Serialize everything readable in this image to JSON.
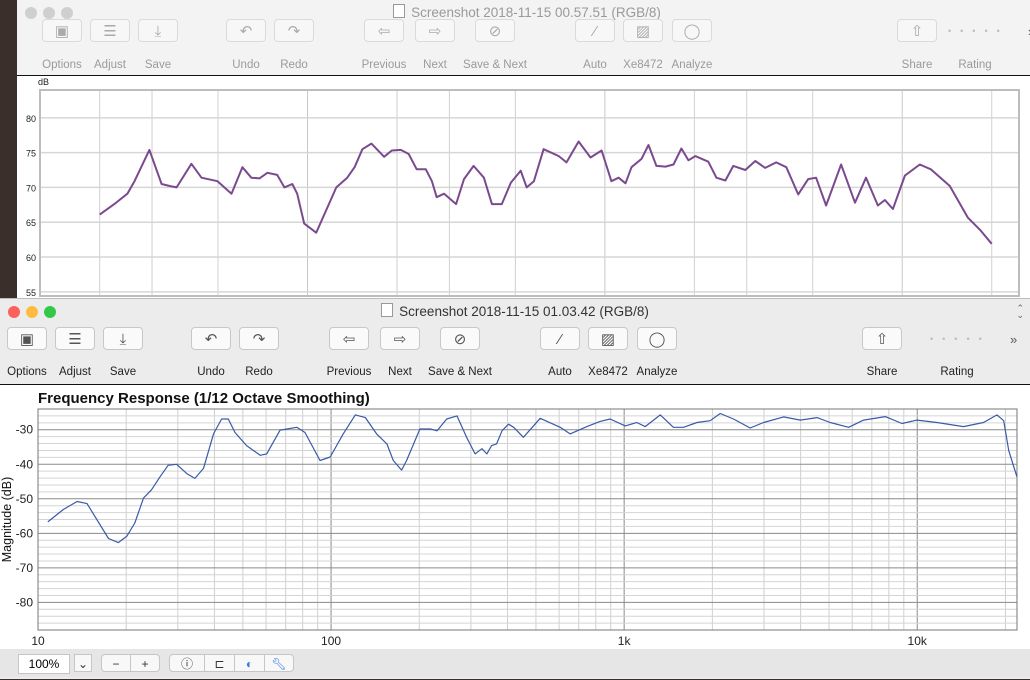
{
  "back_window": {
    "title": "Screenshot 2018-11-15 00.57.51 (RGB/8)",
    "active": false
  },
  "front_window": {
    "title": "Screenshot 2018-11-15 01.03.42 (RGB/8)",
    "active": true,
    "zoom_level": "100%"
  },
  "toolbar": {
    "options": "Options",
    "adjust": "Adjust",
    "save": "Save",
    "undo": "Undo",
    "redo": "Redo",
    "previous": "Previous",
    "next": "Next",
    "save_next": "Save & Next",
    "auto": "Auto",
    "xe8472": "Xe8472",
    "analyze": "Analyze",
    "share": "Share",
    "rating": "Rating"
  },
  "colors": {
    "close": "#fc605c",
    "minimize": "#fdbc40",
    "zoom": "#34c84a",
    "rew_trace": "#7b4a8e",
    "trace": "#3a5aa8"
  },
  "chart_data": [
    {
      "type": "line",
      "title": "",
      "ylabel": "dB",
      "xlabel": "",
      "xscale": "log",
      "xlim": [
        12.6,
        24700
      ],
      "ylim": [
        54.4,
        84
      ],
      "yticks": [
        55,
        60,
        65,
        70,
        75,
        80
      ],
      "grid": true,
      "series": [
        {
          "x": [
            20,
            22.4,
            24.8,
            26.2,
            29.4,
            32.3,
            34.4,
            36.3,
            40.7,
            44,
            49.8,
            55.5,
            60.4,
            64.7,
            68.9,
            73.3,
            79.1,
            83.6,
            88.9,
            92.3,
            97.5,
            107,
            118,
            125,
            136,
            144,
            153,
            164,
            181,
            192,
            206,
            219,
            233,
            250,
            262,
            272,
            288,
            316,
            336,
            362,
            392,
            417,
            450,
            483,
            521,
            546,
            577,
            622,
            700,
            743,
            816,
            895,
            975,
            1052,
            1112,
            1173,
            1229,
            1328,
            1402,
            1490,
            1599,
            1701,
            1808,
            1910,
            2015,
            2228,
            2371,
            2542,
            2704,
            2966,
            3206,
            3460,
            3768,
            4074,
            4467,
            4830,
            5131,
            5548,
            6227,
            6935,
            7553,
            8282,
            8746,
            9305,
            10207,
            11460,
            12480,
            14450,
            16600,
            18360,
            20000
          ],
          "y": [
            66.1,
            67.6,
            69.1,
            70.9,
            75.4,
            70.5,
            70.2,
            70.0,
            73.4,
            71.4,
            70.9,
            69.1,
            72.9,
            71.4,
            71.3,
            72.1,
            71.8,
            70.0,
            70.5,
            69.1,
            64.8,
            63.5,
            67.6,
            70.0,
            71.4,
            72.9,
            75.5,
            76.3,
            74.4,
            75.3,
            75.4,
            74.8,
            72.6,
            72.6,
            70.9,
            68.6,
            69.1,
            67.6,
            71.2,
            73.1,
            71.4,
            67.6,
            67.6,
            70.7,
            72.4,
            70.0,
            70.9,
            75.5,
            74.5,
            73.6,
            76.6,
            74.3,
            75.3,
            70.9,
            71.4,
            70.6,
            72.9,
            74.1,
            76.1,
            73.1,
            73.0,
            73.3,
            75.6,
            73.9,
            74.5,
            73.7,
            71.4,
            71.0,
            73.1,
            72.5,
            73.8,
            72.8,
            73.6,
            72.9,
            69.0,
            71.2,
            71.4,
            67.4,
            73.3,
            67.8,
            71.4,
            67.4,
            68.2,
            66.9,
            71.7,
            73.3,
            72.6,
            70.2,
            65.7,
            63.8,
            61.9
          ]
        }
      ]
    },
    {
      "type": "line",
      "title": "Frequency Response (1/12 Octave Smoothing)",
      "ylabel": "Magnitude (dB)",
      "xlabel": "",
      "xscale": "log",
      "xlim": [
        10,
        21900
      ],
      "ylim": [
        -88,
        -24
      ],
      "xticks": [
        {
          "value": 10,
          "label": "10"
        },
        {
          "value": 100,
          "label": "100"
        },
        {
          "value": 1000,
          "label": "1k"
        },
        {
          "value": 10000,
          "label": "10k"
        }
      ],
      "yticks": [
        -30,
        -40,
        -50,
        -60,
        -70,
        -80
      ],
      "grid": true,
      "series": [
        {
          "x": [
            10.8,
            12.2,
            13.6,
            14.7,
            17.4,
            18.8,
            20.1,
            21.4,
            22.9,
            24.4,
            26.1,
            27.8,
            29.7,
            32.2,
            34.3,
            36.7,
            39.7,
            42.3,
            44.6,
            47,
            51.5,
            57.3,
            60.3,
            67,
            76.4,
            81.5,
            91.7,
            99.3,
            110,
            121,
            131,
            143,
            155,
            163,
            174,
            181,
            201,
            218,
            230,
            248,
            269,
            290,
            310,
            327,
            340,
            353,
            367,
            383,
            403,
            420,
            453,
            517,
            605,
            654,
            746,
            828,
            896,
            1008,
            1104,
            1180,
            1328,
            1473,
            1594,
            1772,
            1966,
            2127,
            2362,
            2692,
            2992,
            3499,
            3990,
            4550,
            5047,
            5834,
            6561,
            7780,
            8870,
            9980,
            11670,
            14390,
            16830,
            18710,
            19720,
            20510,
            21880
          ],
          "y": [
            -56.7,
            -53.1,
            -50.8,
            -51.4,
            -61.5,
            -62.7,
            -60.8,
            -57.0,
            -49.8,
            -47.4,
            -43.6,
            -40.3,
            -40.0,
            -42.7,
            -44.1,
            -41.2,
            -31.2,
            -26.9,
            -26.9,
            -30.8,
            -34.6,
            -37.4,
            -37.0,
            -30.1,
            -29.3,
            -30.8,
            -38.9,
            -37.9,
            -31.2,
            -25.7,
            -26.5,
            -31.2,
            -34.1,
            -38.9,
            -41.7,
            -38.9,
            -29.8,
            -29.8,
            -30.3,
            -26.9,
            -26.0,
            -32.2,
            -37.0,
            -35.5,
            -37.0,
            -34.6,
            -34.1,
            -30.3,
            -28.4,
            -29.3,
            -32.2,
            -26.7,
            -29.3,
            -31.2,
            -29.1,
            -27.6,
            -26.9,
            -28.9,
            -27.9,
            -29.1,
            -25.7,
            -29.3,
            -29.3,
            -27.9,
            -27.4,
            -25.3,
            -26.9,
            -29.5,
            -27.9,
            -26.3,
            -27.2,
            -26.5,
            -27.9,
            -29.3,
            -27.2,
            -26.2,
            -28.2,
            -27.2,
            -27.9,
            -29.1,
            -27.9,
            -25.7,
            -27.4,
            -36.0,
            -43.6
          ]
        }
      ]
    }
  ]
}
